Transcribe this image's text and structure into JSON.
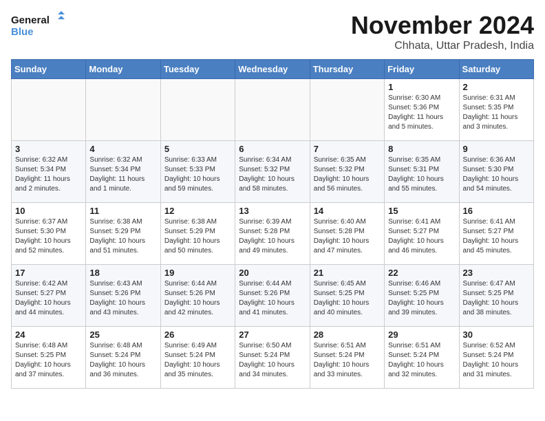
{
  "header": {
    "logo_line1": "General",
    "logo_line2": "Blue",
    "month": "November 2024",
    "location": "Chhata, Uttar Pradesh, India"
  },
  "weekdays": [
    "Sunday",
    "Monday",
    "Tuesday",
    "Wednesday",
    "Thursday",
    "Friday",
    "Saturday"
  ],
  "weeks": [
    [
      {
        "day": "",
        "info": ""
      },
      {
        "day": "",
        "info": ""
      },
      {
        "day": "",
        "info": ""
      },
      {
        "day": "",
        "info": ""
      },
      {
        "day": "",
        "info": ""
      },
      {
        "day": "1",
        "info": "Sunrise: 6:30 AM\nSunset: 5:36 PM\nDaylight: 11 hours\nand 5 minutes."
      },
      {
        "day": "2",
        "info": "Sunrise: 6:31 AM\nSunset: 5:35 PM\nDaylight: 11 hours\nand 3 minutes."
      }
    ],
    [
      {
        "day": "3",
        "info": "Sunrise: 6:32 AM\nSunset: 5:34 PM\nDaylight: 11 hours\nand 2 minutes."
      },
      {
        "day": "4",
        "info": "Sunrise: 6:32 AM\nSunset: 5:34 PM\nDaylight: 11 hours\nand 1 minute."
      },
      {
        "day": "5",
        "info": "Sunrise: 6:33 AM\nSunset: 5:33 PM\nDaylight: 10 hours\nand 59 minutes."
      },
      {
        "day": "6",
        "info": "Sunrise: 6:34 AM\nSunset: 5:32 PM\nDaylight: 10 hours\nand 58 minutes."
      },
      {
        "day": "7",
        "info": "Sunrise: 6:35 AM\nSunset: 5:32 PM\nDaylight: 10 hours\nand 56 minutes."
      },
      {
        "day": "8",
        "info": "Sunrise: 6:35 AM\nSunset: 5:31 PM\nDaylight: 10 hours\nand 55 minutes."
      },
      {
        "day": "9",
        "info": "Sunrise: 6:36 AM\nSunset: 5:30 PM\nDaylight: 10 hours\nand 54 minutes."
      }
    ],
    [
      {
        "day": "10",
        "info": "Sunrise: 6:37 AM\nSunset: 5:30 PM\nDaylight: 10 hours\nand 52 minutes."
      },
      {
        "day": "11",
        "info": "Sunrise: 6:38 AM\nSunset: 5:29 PM\nDaylight: 10 hours\nand 51 minutes."
      },
      {
        "day": "12",
        "info": "Sunrise: 6:38 AM\nSunset: 5:29 PM\nDaylight: 10 hours\nand 50 minutes."
      },
      {
        "day": "13",
        "info": "Sunrise: 6:39 AM\nSunset: 5:28 PM\nDaylight: 10 hours\nand 49 minutes."
      },
      {
        "day": "14",
        "info": "Sunrise: 6:40 AM\nSunset: 5:28 PM\nDaylight: 10 hours\nand 47 minutes."
      },
      {
        "day": "15",
        "info": "Sunrise: 6:41 AM\nSunset: 5:27 PM\nDaylight: 10 hours\nand 46 minutes."
      },
      {
        "day": "16",
        "info": "Sunrise: 6:41 AM\nSunset: 5:27 PM\nDaylight: 10 hours\nand 45 minutes."
      }
    ],
    [
      {
        "day": "17",
        "info": "Sunrise: 6:42 AM\nSunset: 5:27 PM\nDaylight: 10 hours\nand 44 minutes."
      },
      {
        "day": "18",
        "info": "Sunrise: 6:43 AM\nSunset: 5:26 PM\nDaylight: 10 hours\nand 43 minutes."
      },
      {
        "day": "19",
        "info": "Sunrise: 6:44 AM\nSunset: 5:26 PM\nDaylight: 10 hours\nand 42 minutes."
      },
      {
        "day": "20",
        "info": "Sunrise: 6:44 AM\nSunset: 5:26 PM\nDaylight: 10 hours\nand 41 minutes."
      },
      {
        "day": "21",
        "info": "Sunrise: 6:45 AM\nSunset: 5:25 PM\nDaylight: 10 hours\nand 40 minutes."
      },
      {
        "day": "22",
        "info": "Sunrise: 6:46 AM\nSunset: 5:25 PM\nDaylight: 10 hours\nand 39 minutes."
      },
      {
        "day": "23",
        "info": "Sunrise: 6:47 AM\nSunset: 5:25 PM\nDaylight: 10 hours\nand 38 minutes."
      }
    ],
    [
      {
        "day": "24",
        "info": "Sunrise: 6:48 AM\nSunset: 5:25 PM\nDaylight: 10 hours\nand 37 minutes."
      },
      {
        "day": "25",
        "info": "Sunrise: 6:48 AM\nSunset: 5:24 PM\nDaylight: 10 hours\nand 36 minutes."
      },
      {
        "day": "26",
        "info": "Sunrise: 6:49 AM\nSunset: 5:24 PM\nDaylight: 10 hours\nand 35 minutes."
      },
      {
        "day": "27",
        "info": "Sunrise: 6:50 AM\nSunset: 5:24 PM\nDaylight: 10 hours\nand 34 minutes."
      },
      {
        "day": "28",
        "info": "Sunrise: 6:51 AM\nSunset: 5:24 PM\nDaylight: 10 hours\nand 33 minutes."
      },
      {
        "day": "29",
        "info": "Sunrise: 6:51 AM\nSunset: 5:24 PM\nDaylight: 10 hours\nand 32 minutes."
      },
      {
        "day": "30",
        "info": "Sunrise: 6:52 AM\nSunset: 5:24 PM\nDaylight: 10 hours\nand 31 minutes."
      }
    ]
  ]
}
